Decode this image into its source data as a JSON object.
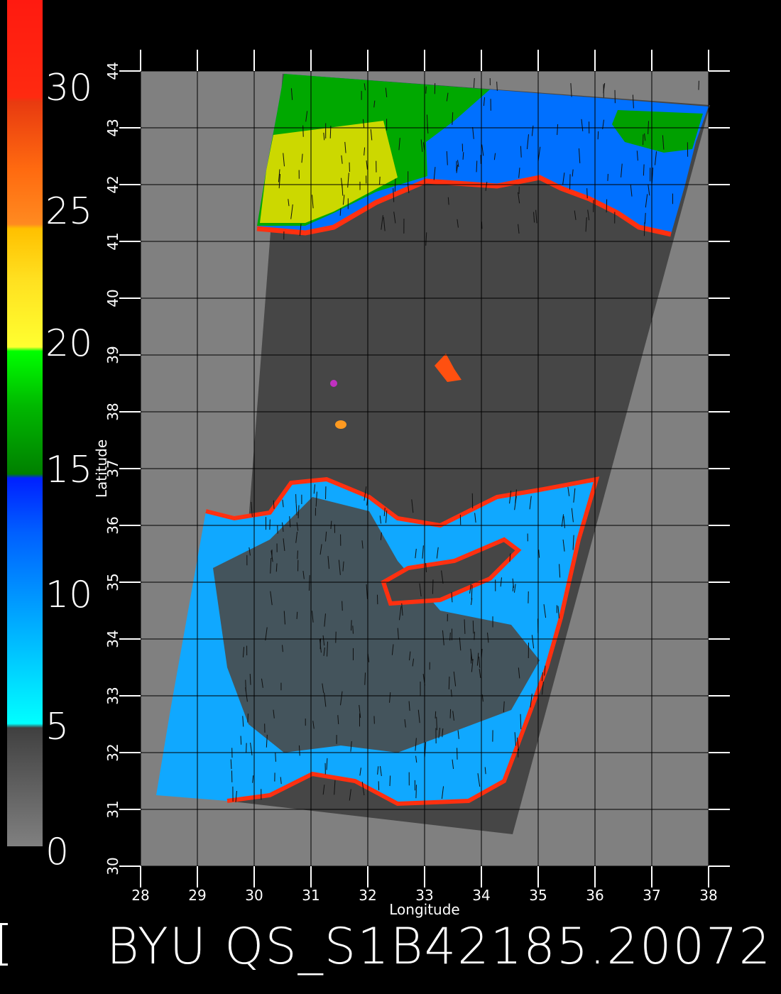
{
  "colorbar": {
    "labels": [
      "30",
      "25",
      "20",
      "15",
      "10",
      "5",
      "0"
    ]
  },
  "map": {
    "xlabel": "Longitude",
    "ylabel": "Latitude",
    "lon_ticks": [
      "28",
      "29",
      "30",
      "31",
      "32",
      "33",
      "34",
      "35",
      "36",
      "37",
      "38"
    ],
    "lat_ticks": [
      "30",
      "31",
      "32",
      "33",
      "34",
      "35",
      "36",
      "37",
      "38",
      "39",
      "40",
      "41",
      "42",
      "43",
      "44"
    ],
    "lon_range": [
      28,
      38
    ],
    "lat_range": [
      30,
      44
    ],
    "colors": {
      "background": "#808080",
      "swath_land": "#464646",
      "ocean_low": "#00c8ff",
      "ocean_mid": "#0060ff",
      "wind_high": "#00b000",
      "wind_very_high": "#ffd800",
      "coast_edge": "#ff2000"
    }
  },
  "footer": {
    "title": "BYU QS_S1B42185.20072"
  }
}
